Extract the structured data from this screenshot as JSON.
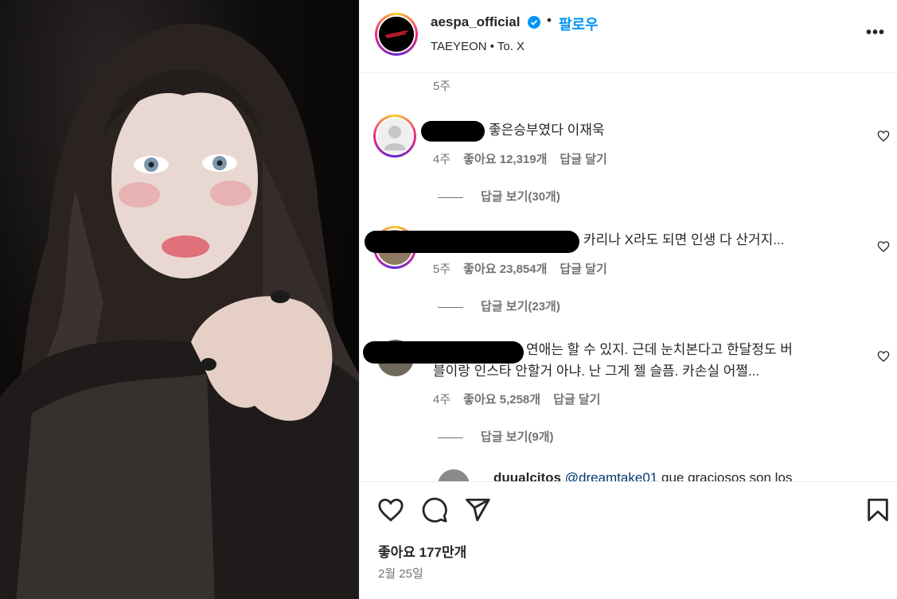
{
  "header": {
    "username": "aespa_official",
    "follow_label": "팔로우",
    "subtitle": "TAEYEON • To. X",
    "more_label": "•••"
  },
  "top_time": "5주",
  "comments": [
    {
      "text": "좋은승부였다 이재욱",
      "time": "4주",
      "likes": "좋아요 12,319개",
      "reply_label": "답글 달기",
      "view_replies": "답글 보기(30개)"
    },
    {
      "text": "카리나 X라도 되면 인생 다 산거지...",
      "time": "5주",
      "likes": "좋아요 23,854개",
      "reply_label": "답글 달기",
      "view_replies": "답글 보기(23개)"
    },
    {
      "text_line1": "연애는 할 수 있지. 근데 눈치본다고 한달정도 버",
      "text_line2": "블이랑 인스타 안할거 아냐. 난 그게 젤 슬픔. 카손실 어쩔...",
      "time": "4주",
      "likes": "좋아요 5,258개",
      "reply_label": "답글 달기",
      "view_replies": "답글 보기(9개)"
    }
  ],
  "nested_reply": {
    "username": "duualcitos",
    "mention": "@dreamtake01",
    "text": "que graciosos son los"
  },
  "footer": {
    "likes": "좋아요 177만개",
    "date": "2월 25일"
  },
  "colors": {
    "accent": "#0095f6",
    "text": "#262626",
    "muted": "#737373"
  }
}
